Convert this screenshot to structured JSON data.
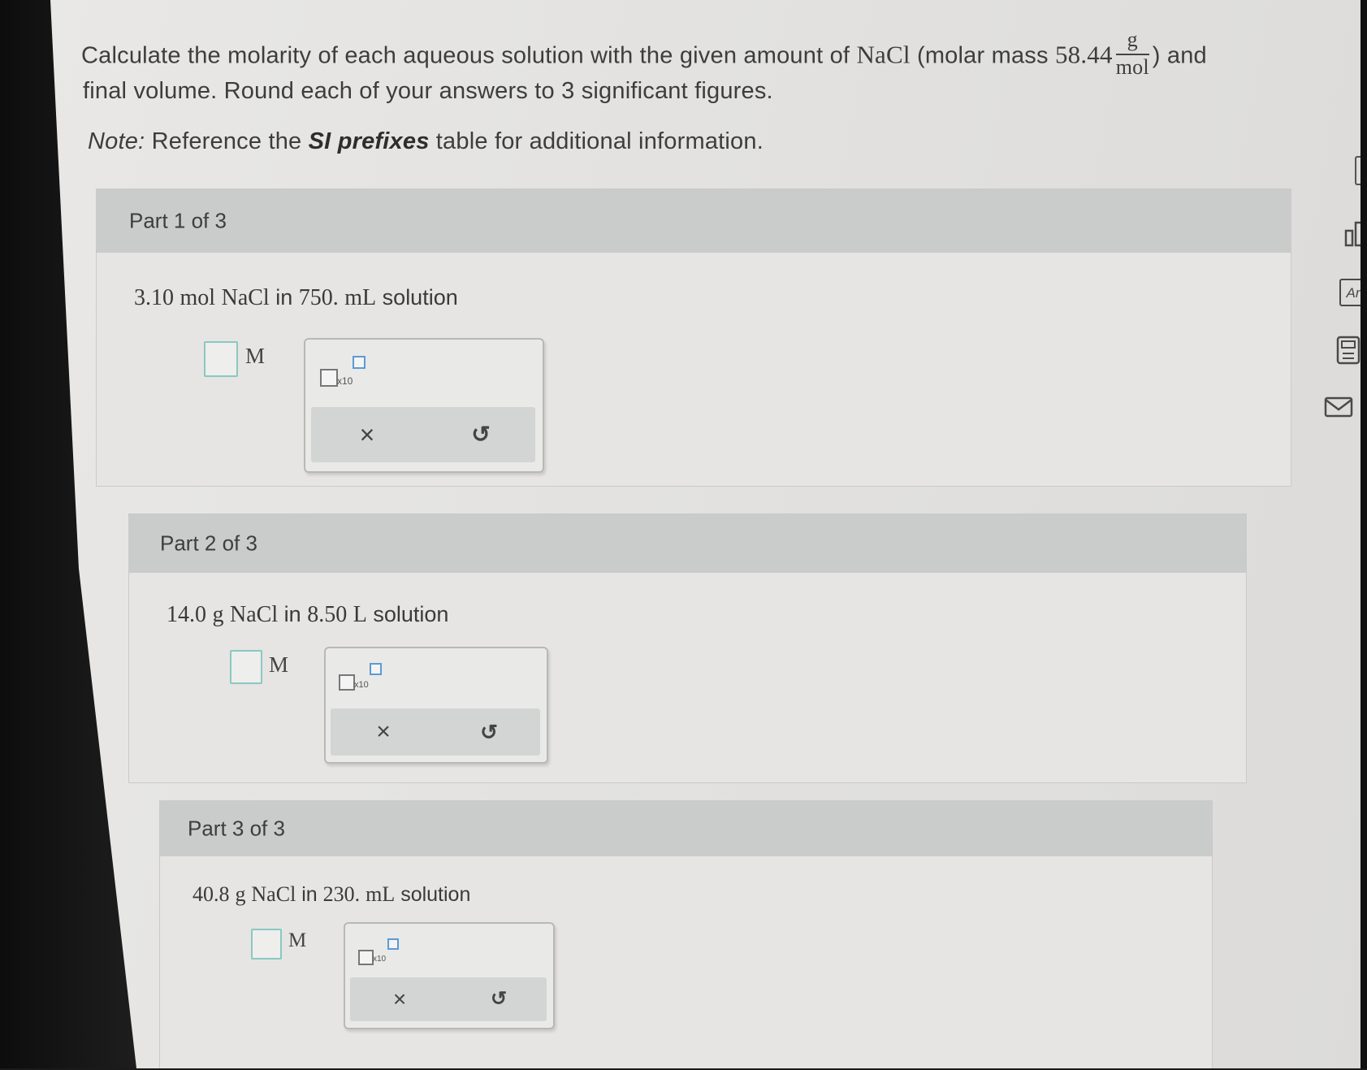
{
  "problem": {
    "line1_prefix": "Calculate the molarity of each aqueous solution with the given amount of",
    "formula": "NaCl",
    "molar_mass_open": "(molar mass",
    "molar_mass_value": "58.44",
    "unit_numerator": "g",
    "unit_denominator": "mol",
    "line1_suffix": ") and",
    "line2": "final volume. Round each of your answers to 3 significant figures.",
    "note_label": "Note:",
    "note_pre": "Reference the",
    "note_bold": "SI prefixes",
    "note_post": "table for additional information."
  },
  "parts": [
    {
      "header": "Part 1 of 3",
      "amount": "3.10",
      "amount_unit": "mol",
      "formula": "NaCl",
      "in_word": "in",
      "volume": "750.",
      "volume_unit": "mL",
      "solution_word": "solution",
      "answer_unit": "M",
      "x10_label": "x10"
    },
    {
      "header": "Part 2 of 3",
      "amount": "14.0",
      "amount_unit": "g",
      "formula": "NaCl",
      "in_word": "in",
      "volume": "8.50",
      "volume_unit": "L",
      "solution_word": "solution",
      "answer_unit": "M",
      "x10_label": "x10"
    },
    {
      "header": "Part 3 of 3",
      "amount": "40.8",
      "amount_unit": "g",
      "formula": "NaCl",
      "in_word": "in",
      "volume": "230.",
      "volume_unit": "mL",
      "solution_word": "solution",
      "answer_unit": "M",
      "x10_label": "x10"
    }
  ],
  "tools": {
    "clear_symbol": "×",
    "reset_symbol": "↺"
  },
  "sidebar": {
    "periodic_label": "Ar"
  },
  "colors": {
    "answer_border": "#8ac8c2",
    "exponent_border": "#5b9bd5",
    "header_bg": "#c9cccb"
  }
}
